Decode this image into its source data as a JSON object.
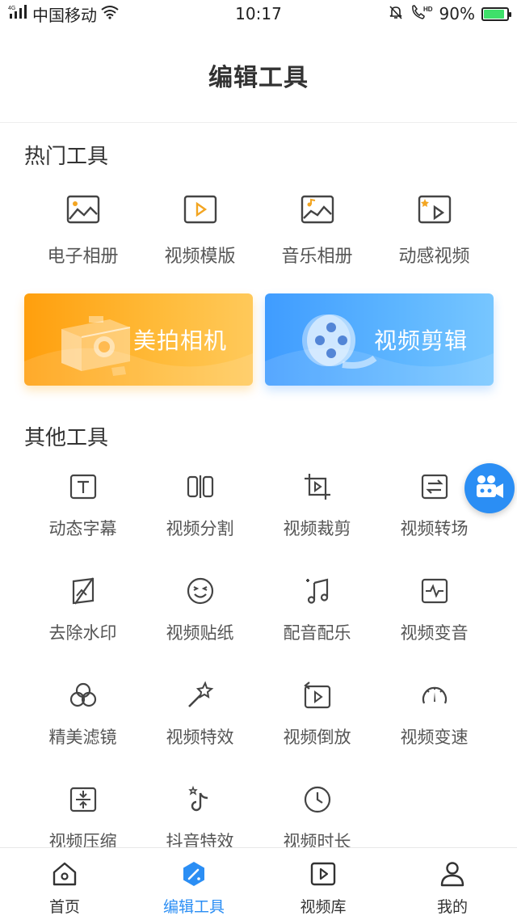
{
  "status_bar": {
    "signal_label": "4G",
    "carrier": "中国移动",
    "time": "10:17",
    "battery": "90%",
    "battery_level": 0.9
  },
  "header": {
    "title": "编辑工具"
  },
  "hot_tools": {
    "title": "热门工具",
    "items": [
      {
        "label": "电子相册",
        "icon": "image-icon"
      },
      {
        "label": "视频模版",
        "icon": "video-play-icon"
      },
      {
        "label": "音乐相册",
        "icon": "music-image-icon"
      },
      {
        "label": "动感视频",
        "icon": "dynamic-video-icon"
      }
    ]
  },
  "banners": {
    "camera": {
      "label": "美拍相机",
      "icon": "camera-icon",
      "color": "#ffa81a"
    },
    "video_edit": {
      "label": "视频剪辑",
      "icon": "film-reel-icon",
      "color": "#4aa8ff"
    }
  },
  "other_tools": {
    "title": "其他工具",
    "items": [
      {
        "label": "动态字幕",
        "icon": "text-icon"
      },
      {
        "label": "视频分割",
        "icon": "split-icon"
      },
      {
        "label": "视频裁剪",
        "icon": "crop-icon"
      },
      {
        "label": "视频转场",
        "icon": "transition-icon"
      },
      {
        "label": "去除水印",
        "icon": "watermark-remove-icon"
      },
      {
        "label": "视频贴纸",
        "icon": "sticker-icon"
      },
      {
        "label": "配音配乐",
        "icon": "music-note-icon"
      },
      {
        "label": "视频变音",
        "icon": "voice-change-icon"
      },
      {
        "label": "精美滤镜",
        "icon": "filter-icon"
      },
      {
        "label": "视频特效",
        "icon": "magic-wand-icon"
      },
      {
        "label": "视频倒放",
        "icon": "reverse-play-icon"
      },
      {
        "label": "视频变速",
        "icon": "speed-gauge-icon"
      },
      {
        "label": "视频压缩",
        "icon": "compress-icon"
      },
      {
        "label": "抖音特效",
        "icon": "tiktok-icon"
      },
      {
        "label": "视频时长",
        "icon": "clock-icon"
      }
    ]
  },
  "fab": {
    "icon": "video-camera-icon"
  },
  "bottom_nav": {
    "items": [
      {
        "label": "首页",
        "icon": "home-icon"
      },
      {
        "label": "编辑工具",
        "icon": "edit-tool-icon",
        "active": true
      },
      {
        "label": "视频库",
        "icon": "video-library-icon"
      },
      {
        "label": "我的",
        "icon": "user-icon"
      }
    ]
  },
  "colors": {
    "accent": "#2b8ef4",
    "text": "#333333",
    "icon": "#444444"
  }
}
